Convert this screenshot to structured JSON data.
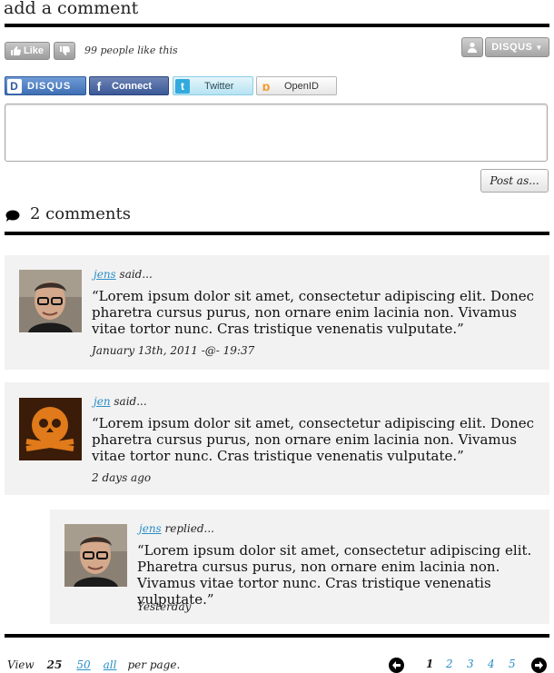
{
  "header": {
    "title": "add a comment"
  },
  "reactions": {
    "like_label": "Like",
    "like_count_text": "99 people like this",
    "disqus_menu_label": "DISQUS"
  },
  "login": {
    "disqus": "DISQUS",
    "facebook": "Connect",
    "twitter": "Twitter",
    "openid": "OpenID"
  },
  "composer": {
    "value": "",
    "post_label": "Post as..."
  },
  "comments_header": {
    "count_label": "2 comments"
  },
  "comments": [
    {
      "author": "jens",
      "verb": " said...",
      "text": "“Lorem ipsum dolor sit amet, consectetur adipiscing elit. Donec pharetra cursus purus, non ornare enim lacinia non. Vivamus vitae tortor nunc. Cras tristique venenatis vulputate.”",
      "date": "January 13th, 2011  -@- 19:37"
    },
    {
      "author": "jen",
      "verb": " said...",
      "text": "“Lorem ipsum dolor sit amet, consectetur adipiscing elit. Donec pharetra cursus purus, non ornare enim lacinia non. Vivamus vitae tortor nunc. Cras tristique venenatis vulputate.”",
      "date": "2 days ago"
    },
    {
      "author": "jens",
      "verb": " replied...",
      "text": "“Lorem ipsum dolor sit amet, consectetur adipiscing elit. Pharetra cursus purus, non ornare enim lacinia non. Vivamus vitae tortor nunc. Cras tristique venenatis vulputate.”",
      "date": "Yesterday"
    }
  ],
  "footer": {
    "view_label": "View",
    "per_page_options": [
      "25",
      "50",
      "all"
    ],
    "per_page_suffix": "per page.",
    "pages": [
      "1",
      "2",
      "3",
      "4",
      "5"
    ]
  },
  "colors": {
    "link": "#2a8fc7",
    "rule": "#000000",
    "comment_bg": "#f2f2f2"
  },
  "icons": [
    "thumbs-up-icon",
    "thumbs-down-icon",
    "user-icon",
    "speech-bubble-icon",
    "arrow-left-icon",
    "arrow-right-icon"
  ]
}
